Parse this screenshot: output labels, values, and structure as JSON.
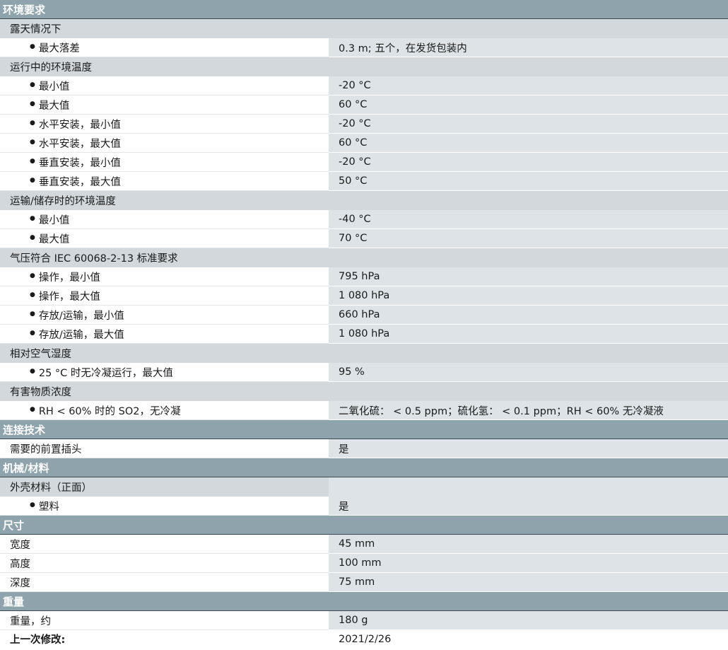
{
  "rows": [
    {
      "type": "section",
      "label": "环境要求"
    },
    {
      "type": "group",
      "label": "露天情况下"
    },
    {
      "type": "item",
      "indent": true,
      "label": "最大落差",
      "value": "0.3 m; 五个，在发货包装内"
    },
    {
      "type": "group",
      "label": "运行中的环境温度"
    },
    {
      "type": "item",
      "indent": true,
      "label": "最小值",
      "value": "-20 °C"
    },
    {
      "type": "item",
      "indent": true,
      "label": "最大值",
      "value": "60 °C"
    },
    {
      "type": "item",
      "indent": true,
      "label": "水平安装，最小值",
      "value": "-20 °C"
    },
    {
      "type": "item",
      "indent": true,
      "label": "水平安装，最大值",
      "value": "60 °C"
    },
    {
      "type": "item",
      "indent": true,
      "label": "垂直安装，最小值",
      "value": "-20 °C"
    },
    {
      "type": "item",
      "indent": true,
      "label": "垂直安装，最大值",
      "value": "50 °C"
    },
    {
      "type": "group",
      "label": "运输/储存时的环境温度"
    },
    {
      "type": "item",
      "indent": true,
      "label": "最小值",
      "value": "-40 °C"
    },
    {
      "type": "item",
      "indent": true,
      "label": "最大值",
      "value": "70 °C"
    },
    {
      "type": "group",
      "label": "气压符合 IEC 60068-2-13 标准要求"
    },
    {
      "type": "item",
      "indent": true,
      "label": "操作，最小值",
      "value": "795 hPa"
    },
    {
      "type": "item",
      "indent": true,
      "label": "操作，最大值",
      "value": "1 080 hPa"
    },
    {
      "type": "item",
      "indent": true,
      "label": "存放/运输，最小值",
      "value": "660 hPa"
    },
    {
      "type": "item",
      "indent": true,
      "label": "存放/运输，最大值",
      "value": "1 080 hPa"
    },
    {
      "type": "group",
      "label": "相对空气湿度"
    },
    {
      "type": "item",
      "indent": true,
      "label": "25 °C 时无冷凝运行，最大值",
      "value": "95 %"
    },
    {
      "type": "group",
      "label": "有害物质浓度"
    },
    {
      "type": "item",
      "indent": true,
      "label": "RH < 60% 时的 SO2，无冷凝",
      "value": "二氧化硫： < 0.5 ppm；硫化氢： < 0.1 ppm；RH < 60% 无冷凝液"
    },
    {
      "type": "section",
      "label": "连接技术"
    },
    {
      "type": "item",
      "indent": false,
      "label": "需要的前置插头",
      "value": "是"
    },
    {
      "type": "section",
      "label": "机械/材料"
    },
    {
      "type": "item",
      "indent": false,
      "grpside": true,
      "label": "外壳材料（正面）",
      "value": ""
    },
    {
      "type": "item",
      "indent": true,
      "label": "塑料",
      "value": "是"
    },
    {
      "type": "section",
      "label": "尺寸"
    },
    {
      "type": "item",
      "indent": false,
      "label": "宽度",
      "value": "45 mm"
    },
    {
      "type": "item",
      "indent": false,
      "label": "高度",
      "value": "100 mm"
    },
    {
      "type": "item",
      "indent": false,
      "label": "深度",
      "value": "75 mm"
    },
    {
      "type": "section",
      "label": "重量"
    },
    {
      "type": "item",
      "indent": false,
      "label": "重量，约",
      "value": "180 g"
    }
  ],
  "footer": {
    "label": "上一次修改:",
    "value": "2021/2/26"
  },
  "bullet_glyph": "●",
  "colors": {
    "section_bg": "#8fa3ad",
    "group_bg": "#d2d8dc",
    "value_bg": "#dde3e6"
  }
}
